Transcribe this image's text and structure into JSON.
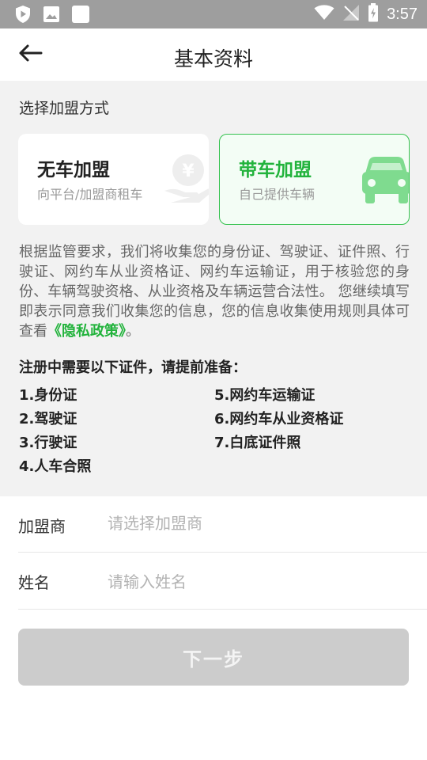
{
  "status_bar": {
    "time": "3:57",
    "icons": [
      "shield-play-icon",
      "image-icon",
      "square-icon",
      "wifi-icon",
      "signal-off-icon",
      "battery-charging-icon"
    ],
    "bg_color": "#9e9e9e"
  },
  "header": {
    "title": "基本资料",
    "back_icon": "arrow-left-icon"
  },
  "join_section": {
    "label": "选择加盟方式",
    "options": [
      {
        "title": "无车加盟",
        "subtitle": "向平台/加盟商租车",
        "icon": "yen-hand-icon",
        "selected": false
      },
      {
        "title": "带车加盟",
        "subtitle": "自己提供车辆",
        "icon": "car-icon",
        "selected": true
      }
    ],
    "accent_color": "#22b33c"
  },
  "notice": {
    "text": "根据监管要求，我们将收集您的身份证、驾驶证、证件照、行驶证、网约车从业资格证、网约车运输证，用于核验您的身份、车辆驾驶资格、从业资格及车辆运营合法性。 您继续填写即表示同意我们收集您的信息，您的信息收集使用规则具体可查看",
    "link_text": "《隐私政策》",
    "suffix": "。"
  },
  "requirements": {
    "title": "注册中需要以下证件，请提前准备：",
    "items": [
      "1.身份证",
      "2.驾驶证",
      "3.行驶证",
      "4.人车合照",
      "5.网约车运输证",
      "6.网约车从业资格证",
      "7.白底证件照"
    ]
  },
  "form": {
    "franchisee": {
      "label": "加盟商",
      "placeholder": "请选择加盟商"
    },
    "name": {
      "label": "姓名",
      "placeholder": "请输入姓名"
    }
  },
  "next_button": {
    "label": "下一步",
    "enabled": false
  }
}
